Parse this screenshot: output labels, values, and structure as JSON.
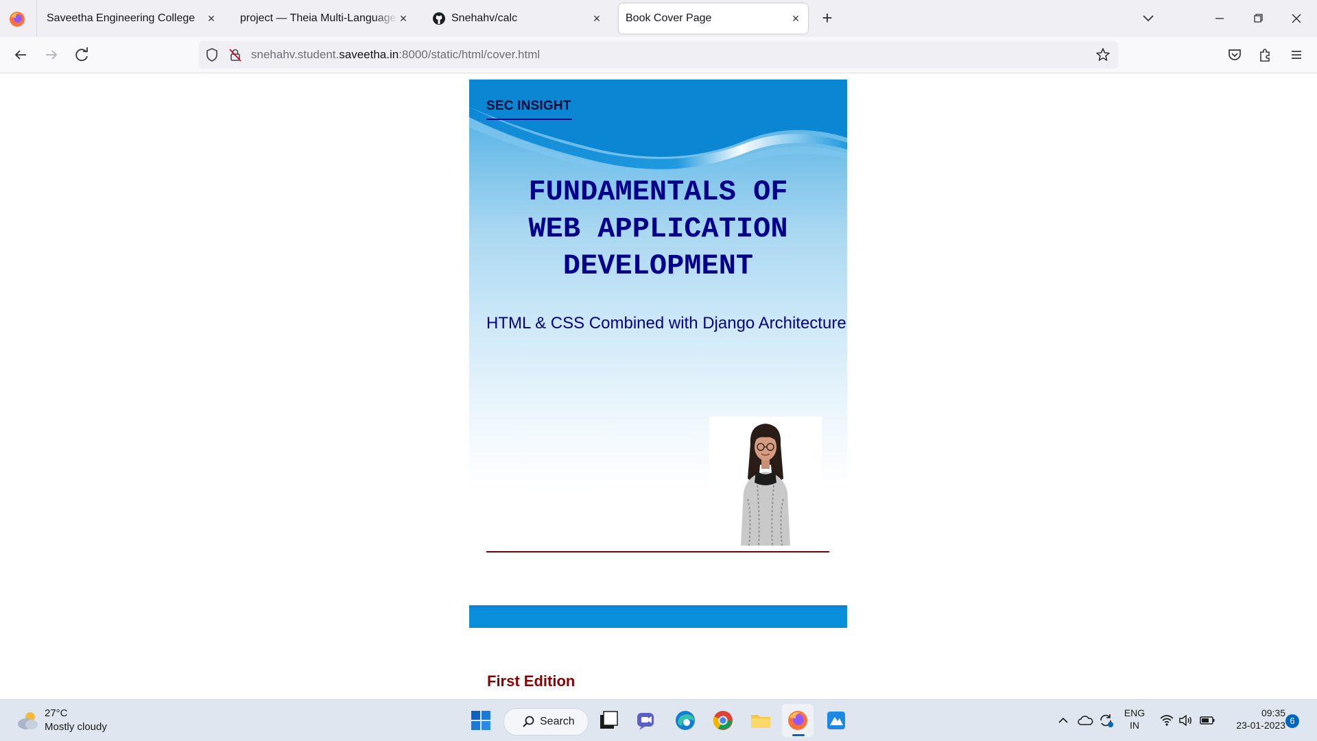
{
  "browser": {
    "tabs": [
      {
        "title": "Saveetha Engineering College",
        "icon": "firefox-icon"
      },
      {
        "title": "project — Theia Multi-Language Ex",
        "icon": "none"
      },
      {
        "title": "Snehahv/calc",
        "icon": "github-icon"
      },
      {
        "title": "Book Cover Page",
        "icon": "none",
        "active": true
      }
    ],
    "url": {
      "prefix": "snehahv.student.",
      "host": "saveetha.in",
      "suffix": ":8000/static/html/cover.html"
    }
  },
  "cover": {
    "brand": "SEC INSIGHT",
    "title_lines": [
      "FUNDAMENTALS OF",
      "WEB APPLICATION",
      "DEVELOPMENT"
    ],
    "subtitle": "HTML & CSS Combined with Django Architecture",
    "edition": "First Edition",
    "colors": {
      "title": "#00008b",
      "edition": "#8b0000",
      "band": "#0a8fdc"
    }
  },
  "taskbar": {
    "weather": {
      "temp": "27°C",
      "desc": "Mostly cloudy"
    },
    "search_label": "Search",
    "lang": {
      "line1": "ENG",
      "line2": "IN"
    },
    "clock": {
      "time": "09:35",
      "date": "23-01-2023"
    },
    "notifications": "6"
  }
}
